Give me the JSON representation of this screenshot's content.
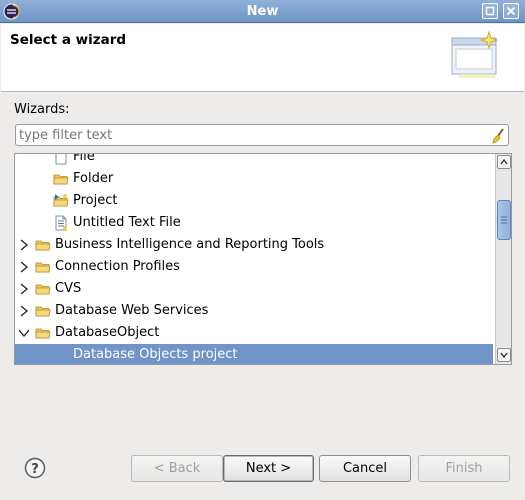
{
  "window": {
    "title": "New",
    "controls": [
      "restore-icon",
      "close-icon"
    ]
  },
  "banner": {
    "heading": "Select a wizard",
    "icon": "wizard-banner-icon"
  },
  "wizards_label": "Wizards:",
  "filter": {
    "placeholder": "type filter text",
    "value": "",
    "clear_icon": "broom-clear-icon"
  },
  "tree": {
    "items": [
      {
        "label": "File",
        "icon": "file-icon",
        "level": 2,
        "expander": "none",
        "selected": false
      },
      {
        "label": "Folder",
        "icon": "folder-icon",
        "level": 2,
        "expander": "none",
        "selected": false
      },
      {
        "label": "Project",
        "icon": "project-icon",
        "level": 2,
        "expander": "none",
        "selected": false
      },
      {
        "label": "Untitled Text File",
        "icon": "text-file-icon",
        "level": 2,
        "expander": "none",
        "selected": false
      },
      {
        "label": "Business Intelligence and Reporting Tools",
        "icon": "folder-icon",
        "level": 1,
        "expander": "collapsed",
        "selected": false
      },
      {
        "label": "Connection Profiles",
        "icon": "folder-icon",
        "level": 1,
        "expander": "collapsed",
        "selected": false
      },
      {
        "label": "CVS",
        "icon": "folder-icon",
        "level": 1,
        "expander": "collapsed",
        "selected": false
      },
      {
        "label": "Database Web Services",
        "icon": "folder-icon",
        "level": 1,
        "expander": "collapsed",
        "selected": false
      },
      {
        "label": "DatabaseObject",
        "icon": "folder-icon",
        "level": 1,
        "expander": "expanded",
        "selected": false
      },
      {
        "label": "Database Objects project",
        "icon": "",
        "level": 2,
        "expander": "none",
        "selected": true
      }
    ]
  },
  "buttons": {
    "help_icon": "help-icon",
    "back": "< Back",
    "next": "Next >",
    "cancel": "Cancel",
    "finish": "Finish"
  },
  "colors": {
    "selection": "#7093c8",
    "titlebar": "#7b9fce",
    "folder": "#e8b84a"
  }
}
